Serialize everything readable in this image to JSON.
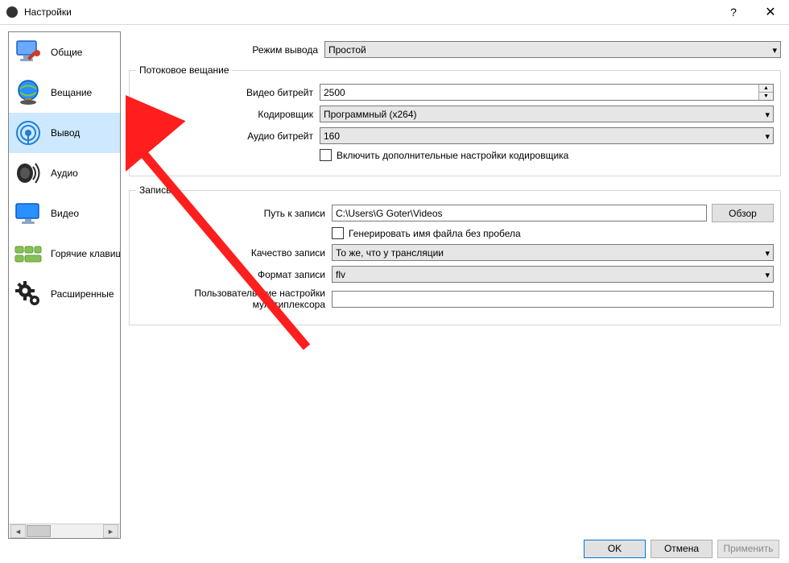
{
  "window": {
    "title": "Настройки"
  },
  "sidebar": {
    "items": [
      {
        "label": "Общие"
      },
      {
        "label": "Вещание"
      },
      {
        "label": "Вывод"
      },
      {
        "label": "Аудио"
      },
      {
        "label": "Видео"
      },
      {
        "label": "Горячие клавиши"
      },
      {
        "label": "Расширенные"
      }
    ]
  },
  "output_mode": {
    "label": "Режим вывода",
    "value": "Простой"
  },
  "streaming": {
    "legend": "Потоковое вещание",
    "video_bitrate": {
      "label": "Видео битрейт",
      "value": "2500"
    },
    "encoder": {
      "label": "Кодировщик",
      "value": "Программный (x264)"
    },
    "audio_bitrate": {
      "label": "Аудио битрейт",
      "value": "160"
    },
    "advanced_checkbox": {
      "label": "Включить дополнительные настройки кодировщика"
    }
  },
  "recording": {
    "legend": "Запись",
    "path": {
      "label": "Путь к записи",
      "value": "C:\\Users\\G Goter\\Videos",
      "browse": "Обзор"
    },
    "gen_name": {
      "label": "Генерировать имя файла без пробела"
    },
    "quality": {
      "label": "Качество записи",
      "value": "То же, что у трансляции"
    },
    "format": {
      "label": "Формат записи",
      "value": "flv"
    },
    "mux": {
      "label": "Пользовательские настройки мультиплексора",
      "value": ""
    }
  },
  "buttons": {
    "ok": "OK",
    "cancel": "Отмена",
    "apply": "Применить"
  }
}
